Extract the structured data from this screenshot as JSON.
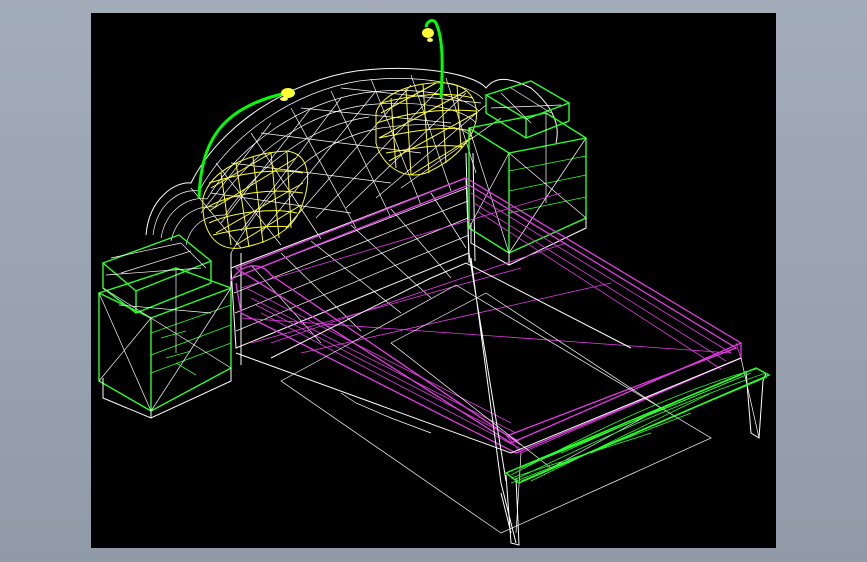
{
  "viewport": {
    "background": "#000000",
    "wire_colors": {
      "frame": "#ffffff",
      "nightstands": "#2bff2b",
      "bed_rails": "#e53be5",
      "pillows": "#ffff33",
      "lamp_stems": "#00ff00"
    }
  },
  "window": {
    "background": "#9aa4b1"
  }
}
